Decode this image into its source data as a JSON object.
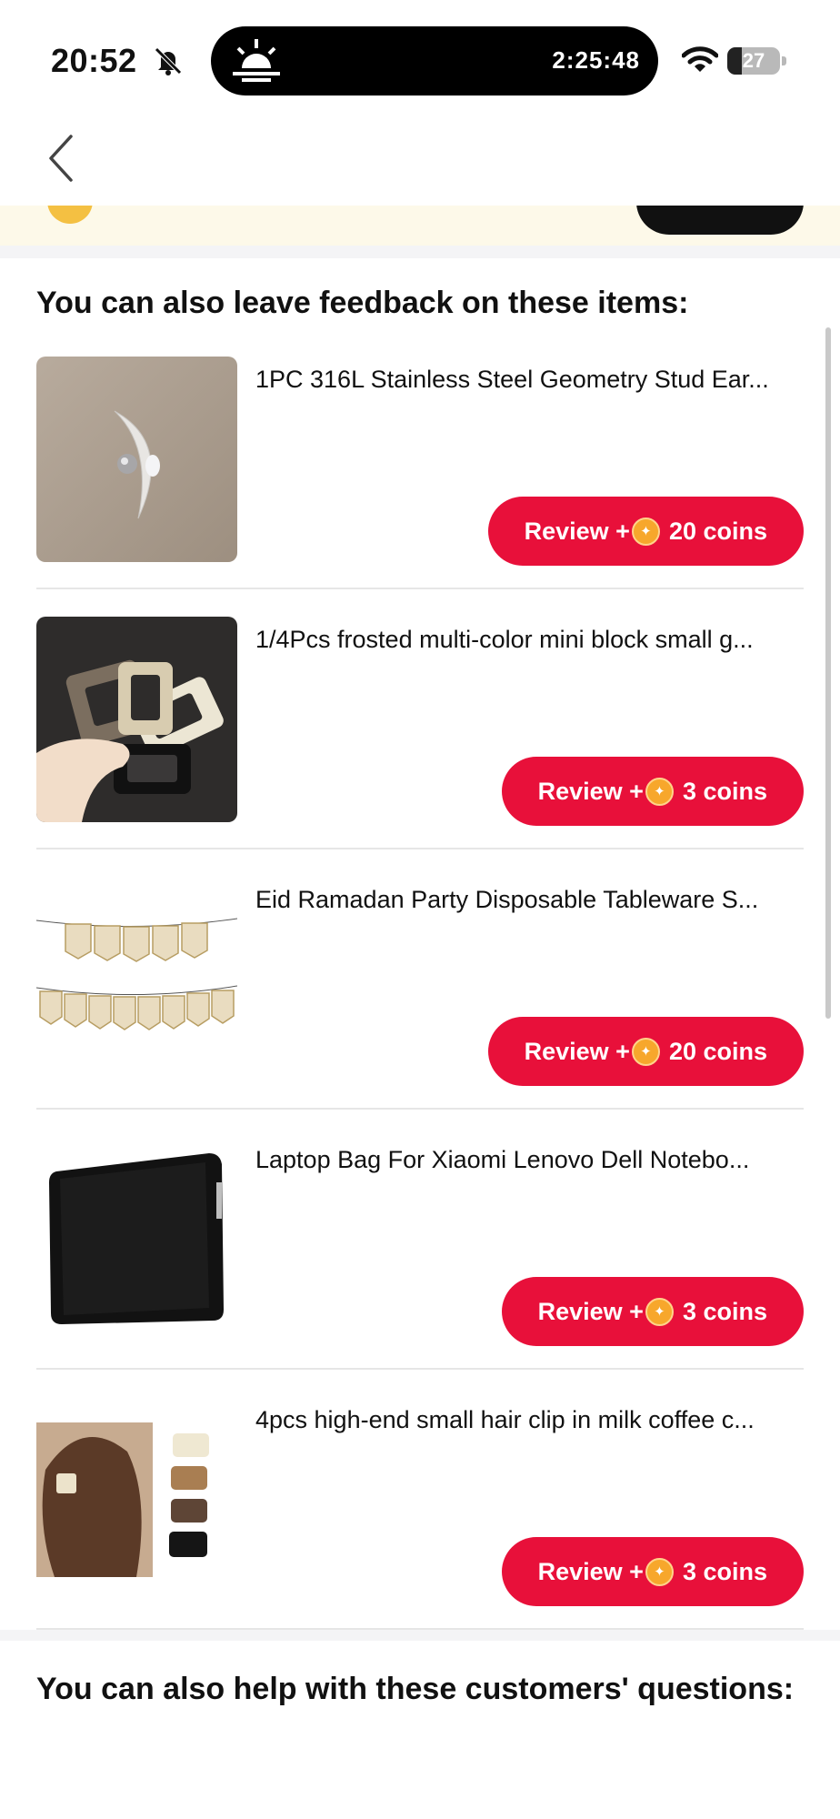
{
  "status_bar": {
    "time": "20:52",
    "island_timer": "2:25:48",
    "battery_level": "27",
    "battery_fraction": 0.27
  },
  "header": {
    "back_icon": "chevron-left-icon"
  },
  "feedback_section": {
    "title": "You can also leave feedback on these items:",
    "items": [
      {
        "title": "1PC 316L Stainless Steel Geometry Stud Ear...",
        "review_label": "Review +",
        "coins_label": "20 coins",
        "thumb": "earring"
      },
      {
        "title": "1/4Pcs frosted multi-color mini block small g...",
        "review_label": "Review +",
        "coins_label": "3 coins",
        "thumb": "hair-claw-clips"
      },
      {
        "title": "Eid Ramadan Party Disposable Tableware S...",
        "review_label": "Review +",
        "coins_label": "20 coins",
        "thumb": "eid-mubarak-banner"
      },
      {
        "title": "Laptop Bag For Xiaomi Lenovo Dell Notebo...",
        "review_label": "Review +",
        "coins_label": "3 coins",
        "thumb": "laptop-sleeve"
      },
      {
        "title": "4pcs high-end small hair clip in milk coffee c...",
        "review_label": "Review +",
        "coins_label": "3 coins",
        "thumb": "hair-clips-set"
      }
    ]
  },
  "questions_section": {
    "title": "You can also help with these customers' questions:"
  },
  "colors": {
    "accent": "#e8103a",
    "coin": "#f7a72c",
    "banner_bg": "#fdf9e9"
  }
}
